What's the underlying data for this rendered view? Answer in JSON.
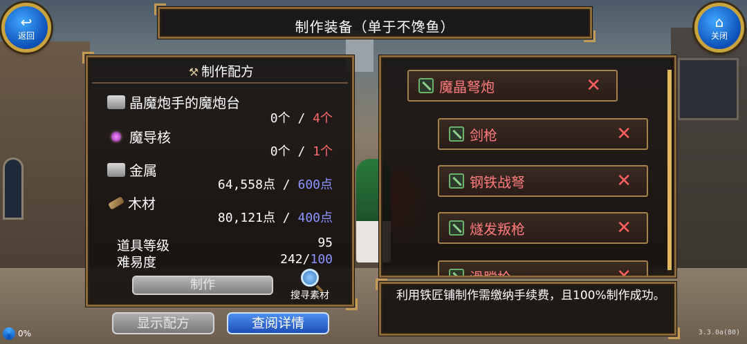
{
  "header": {
    "title": "制作装备（单于不馋鱼）",
    "back_label": "返回",
    "close_label": "关闭"
  },
  "recipe": {
    "heading": "制作配方",
    "materials": [
      {
        "name": "晶魔炮手的魔炮台",
        "owned": "0个",
        "sep": "/",
        "required": "4个",
        "icon": "anvil-icon"
      },
      {
        "name": "魔导核",
        "owned": "0个",
        "sep": "/",
        "required": "1个",
        "icon": "magic-core-icon"
      },
      {
        "name": "金属",
        "owned": "64,558点",
        "sep": "/",
        "required": "600点",
        "icon": "metal-icon"
      },
      {
        "name": "木材",
        "owned": "80,121点",
        "sep": "/",
        "required": "400点",
        "icon": "wood-icon"
      }
    ],
    "item_level_label": "道具等级",
    "item_level_value": "95",
    "difficulty_label": "难易度",
    "difficulty_current": "242",
    "difficulty_sep": "/",
    "difficulty_max": "100",
    "craft_label": "制作",
    "search_material_label": "搜寻素材"
  },
  "buttons": {
    "show_recipe": "显示配方",
    "view_detail": "查阅详情"
  },
  "list": {
    "items": [
      {
        "label": "魔晶弩炮"
      },
      {
        "label": "剑枪"
      },
      {
        "label": "钢铁战弩"
      },
      {
        "label": "燧发叛枪"
      },
      {
        "label": "滑膛枪"
      }
    ]
  },
  "info": {
    "text": "利用铁匠铺制作需缴纳手续费，且100%制作成功。"
  },
  "status": {
    "progress": "0%",
    "version": "3.3.0a(80)"
  },
  "colors": {
    "required_missing": "#ff6b6b",
    "required_ok": "#8c95ff",
    "list_text": "#ff7c7c",
    "frame_gold": "#c59a52",
    "primary_button": "#1d4fb8"
  }
}
